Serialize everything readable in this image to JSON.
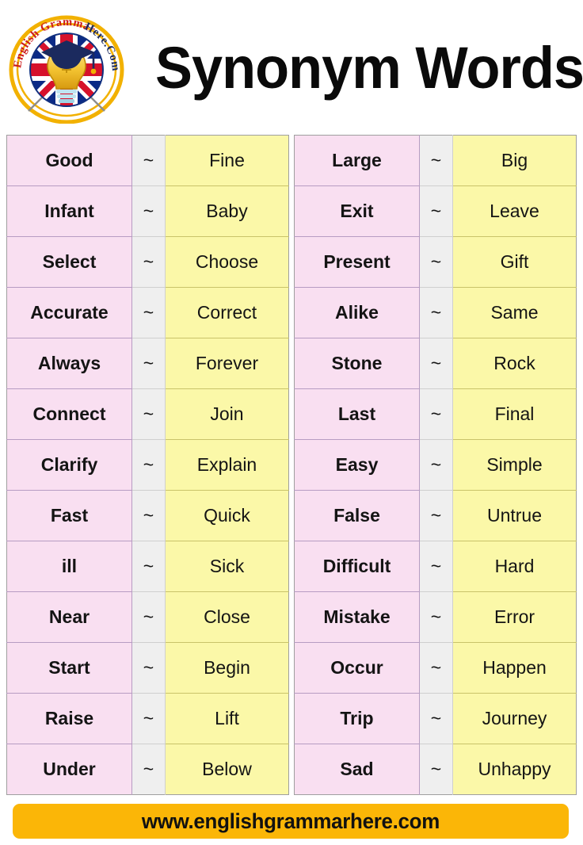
{
  "header": {
    "title": "Synonym Words",
    "logo": {
      "icon": "english-grammar-here-badge-icon",
      "text_top": "English Grammar",
      "text_bottom": "Here.Com",
      "ring_color": "#f2b100",
      "text_color_primary": "#cc1a1a",
      "text_color_secondary": "#1b2a5e"
    }
  },
  "table": {
    "separator_symbol": "~",
    "colors": {
      "word_cell": "#f9dff1",
      "synonym_cell": "#fbf8a8",
      "separator_cell": "#efefef",
      "border_pink": "#b79cc3",
      "border_yellow": "#c9c36a",
      "footer_bar": "#fbb607"
    },
    "left_column": [
      {
        "word": "Good",
        "synonym": "Fine"
      },
      {
        "word": "Infant",
        "synonym": "Baby"
      },
      {
        "word": "Select",
        "synonym": "Choose"
      },
      {
        "word": "Accurate",
        "synonym": "Correct"
      },
      {
        "word": "Always",
        "synonym": "Forever"
      },
      {
        "word": "Connect",
        "synonym": "Join"
      },
      {
        "word": "Clarify",
        "synonym": "Explain"
      },
      {
        "word": "Fast",
        "synonym": "Quick"
      },
      {
        "word": "ill",
        "synonym": "Sick"
      },
      {
        "word": "Near",
        "synonym": "Close"
      },
      {
        "word": "Start",
        "synonym": "Begin"
      },
      {
        "word": "Raise",
        "synonym": "Lift"
      },
      {
        "word": "Under",
        "synonym": "Below"
      }
    ],
    "right_column": [
      {
        "word": "Large",
        "synonym": "Big"
      },
      {
        "word": "Exit",
        "synonym": "Leave"
      },
      {
        "word": "Present",
        "synonym": "Gift"
      },
      {
        "word": "Alike",
        "synonym": "Same"
      },
      {
        "word": "Stone",
        "synonym": "Rock"
      },
      {
        "word": "Last",
        "synonym": "Final"
      },
      {
        "word": "Easy",
        "synonym": "Simple"
      },
      {
        "word": "False",
        "synonym": "Untrue"
      },
      {
        "word": "Difficult",
        "synonym": "Hard"
      },
      {
        "word": "Mistake",
        "synonym": "Error"
      },
      {
        "word": "Occur",
        "synonym": "Happen"
      },
      {
        "word": "Trip",
        "synonym": "Journey"
      },
      {
        "word": "Sad",
        "synonym": "Unhappy"
      }
    ]
  },
  "footer": {
    "website": "www.englishgrammarhere.com"
  }
}
